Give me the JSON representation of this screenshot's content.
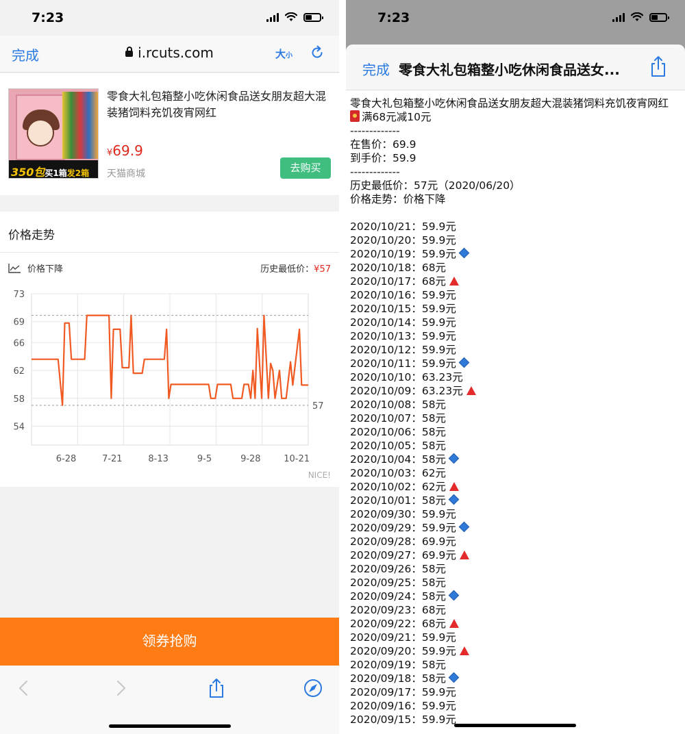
{
  "status": {
    "time": "7:23"
  },
  "left": {
    "nav": {
      "done": "完成",
      "url": "i.rcuts.com",
      "text_size_big": "大",
      "text_size_small": "小"
    },
    "product": {
      "title": "零食大礼包箱整小吃休闲食品送女朋友超大混装猪饲料充饥夜宵网红",
      "price_symbol": "¥",
      "price": "69.9",
      "shop": "天猫商城",
      "buy_label": "去购买",
      "image_text": {
        "count": "350",
        "unit": "包",
        "buy": "买1箱",
        "send": "发2箱"
      }
    },
    "trend": {
      "header": "价格走势",
      "subtitle": "价格下降",
      "lowest_label": "历史最低价：",
      "lowest_value": "¥57",
      "nice": "NICE!"
    },
    "coupon_label": "领券抢购"
  },
  "chart_data": {
    "type": "line",
    "x_tick_labels": [
      "6-28",
      "7-21",
      "8-13",
      "9-5",
      "9-28",
      "10-21"
    ],
    "y_tick_labels": [
      "73",
      "69",
      "66",
      "62",
      "58",
      "54"
    ],
    "ylim": [
      51.3,
      73
    ],
    "reference_lines": [
      {
        "value": 69.9
      },
      {
        "value": 57,
        "label": "57"
      }
    ],
    "series": [
      {
        "color": "#f05a22",
        "points": [
          [
            0,
            63.6
          ],
          [
            9,
            63.6
          ],
          [
            12,
            63.6
          ],
          [
            14,
            57
          ],
          [
            15,
            68.8
          ],
          [
            17,
            68.8
          ],
          [
            18,
            63.6
          ],
          [
            24,
            63.6
          ],
          [
            25,
            69.9
          ],
          [
            35,
            69.9
          ],
          [
            36,
            58
          ],
          [
            37,
            67.9
          ],
          [
            40,
            67.9
          ],
          [
            41,
            62.4
          ],
          [
            44,
            62.4
          ],
          [
            45,
            69.9
          ],
          [
            46,
            61.6
          ],
          [
            50,
            61.6
          ],
          [
            51,
            63.6
          ],
          [
            60,
            63.6
          ],
          [
            61,
            67.9
          ],
          [
            62,
            58
          ],
          [
            63,
            60
          ],
          [
            80,
            60
          ],
          [
            81,
            58
          ],
          [
            83,
            58
          ],
          [
            84,
            60
          ],
          [
            90,
            60
          ],
          [
            91,
            58
          ],
          [
            95,
            58
          ],
          [
            96,
            60
          ],
          [
            98,
            60
          ],
          [
            99,
            58
          ],
          [
            100,
            62
          ],
          [
            101,
            58
          ],
          [
            102,
            68
          ],
          [
            104,
            58
          ],
          [
            105,
            69.9
          ],
          [
            107,
            58
          ],
          [
            108,
            63
          ],
          [
            109,
            62
          ],
          [
            110,
            58
          ],
          [
            112,
            62
          ],
          [
            113,
            58
          ],
          [
            115,
            58
          ],
          [
            117,
            63.23
          ],
          [
            118,
            59.9
          ],
          [
            121,
            67.9
          ],
          [
            122,
            59.9
          ],
          [
            125,
            59.9
          ]
        ]
      }
    ]
  },
  "right": {
    "sheet": {
      "done": "完成",
      "title": "零食大礼包箱整小吃休闲食品送女..."
    },
    "text": {
      "title": "零食大礼包箱整小吃休闲食品送女朋友超大混装猪饲料充饥夜宵网红",
      "promo": "满68元减10元",
      "divider": "-------------",
      "on_sale_price": "在售价：69.9",
      "final_price": "到手价：59.9",
      "history_low": "历史最低价：57元（2020/06/20）",
      "trend": "价格走势：价格下降"
    },
    "history": [
      {
        "text": "2020/10/21：59.9元",
        "mark": ""
      },
      {
        "text": "2020/10/20：59.9元",
        "mark": ""
      },
      {
        "text": "2020/10/19：59.9元",
        "mark": "down"
      },
      {
        "text": "2020/10/18：68元",
        "mark": ""
      },
      {
        "text": "2020/10/17：68元",
        "mark": "up"
      },
      {
        "text": "2020/10/16：59.9元",
        "mark": ""
      },
      {
        "text": "2020/10/15：59.9元",
        "mark": ""
      },
      {
        "text": "2020/10/14：59.9元",
        "mark": ""
      },
      {
        "text": "2020/10/13：59.9元",
        "mark": ""
      },
      {
        "text": "2020/10/12：59.9元",
        "mark": ""
      },
      {
        "text": "2020/10/11：59.9元",
        "mark": "down"
      },
      {
        "text": "2020/10/10：63.23元",
        "mark": ""
      },
      {
        "text": "2020/10/09：63.23元",
        "mark": "up"
      },
      {
        "text": "2020/10/08：58元",
        "mark": ""
      },
      {
        "text": "2020/10/07：58元",
        "mark": ""
      },
      {
        "text": "2020/10/06：58元",
        "mark": ""
      },
      {
        "text": "2020/10/05：58元",
        "mark": ""
      },
      {
        "text": "2020/10/04：58元",
        "mark": "down"
      },
      {
        "text": "2020/10/03：62元",
        "mark": ""
      },
      {
        "text": "2020/10/02：62元",
        "mark": "up"
      },
      {
        "text": "2020/10/01：58元",
        "mark": "down"
      },
      {
        "text": "2020/09/30：59.9元",
        "mark": ""
      },
      {
        "text": "2020/09/29：59.9元",
        "mark": "down"
      },
      {
        "text": "2020/09/28：69.9元",
        "mark": ""
      },
      {
        "text": "2020/09/27：69.9元",
        "mark": "up"
      },
      {
        "text": "2020/09/26：58元",
        "mark": ""
      },
      {
        "text": "2020/09/25：58元",
        "mark": ""
      },
      {
        "text": "2020/09/24：58元",
        "mark": "down"
      },
      {
        "text": "2020/09/23：68元",
        "mark": ""
      },
      {
        "text": "2020/09/22：68元",
        "mark": "up"
      },
      {
        "text": "2020/09/21：59.9元",
        "mark": ""
      },
      {
        "text": "2020/09/20：59.9元",
        "mark": "up"
      },
      {
        "text": "2020/09/19：58元",
        "mark": ""
      },
      {
        "text": "2020/09/18：58元",
        "mark": "down"
      },
      {
        "text": "2020/09/17：59.9元",
        "mark": ""
      },
      {
        "text": "2020/09/16：59.9元",
        "mark": ""
      },
      {
        "text": "2020/09/15：59.9元",
        "mark": ""
      }
    ]
  },
  "colors": {
    "ios_blue": "#2a7ae2",
    "price_red": "#e0281d",
    "buy_green": "#3fbe80",
    "coupon_orange": "#ff7b13",
    "line_orange": "#f05a22"
  },
  "icons": [
    "wifi-icon",
    "cellular-signal-icon",
    "battery-icon",
    "lock-icon",
    "reload-icon",
    "trend-chart-icon",
    "back-arrow-icon",
    "forward-arrow-icon",
    "share-icon",
    "compass-icon",
    "red-envelope-icon",
    "blue-diamond-icon",
    "red-triangle-icon"
  ]
}
